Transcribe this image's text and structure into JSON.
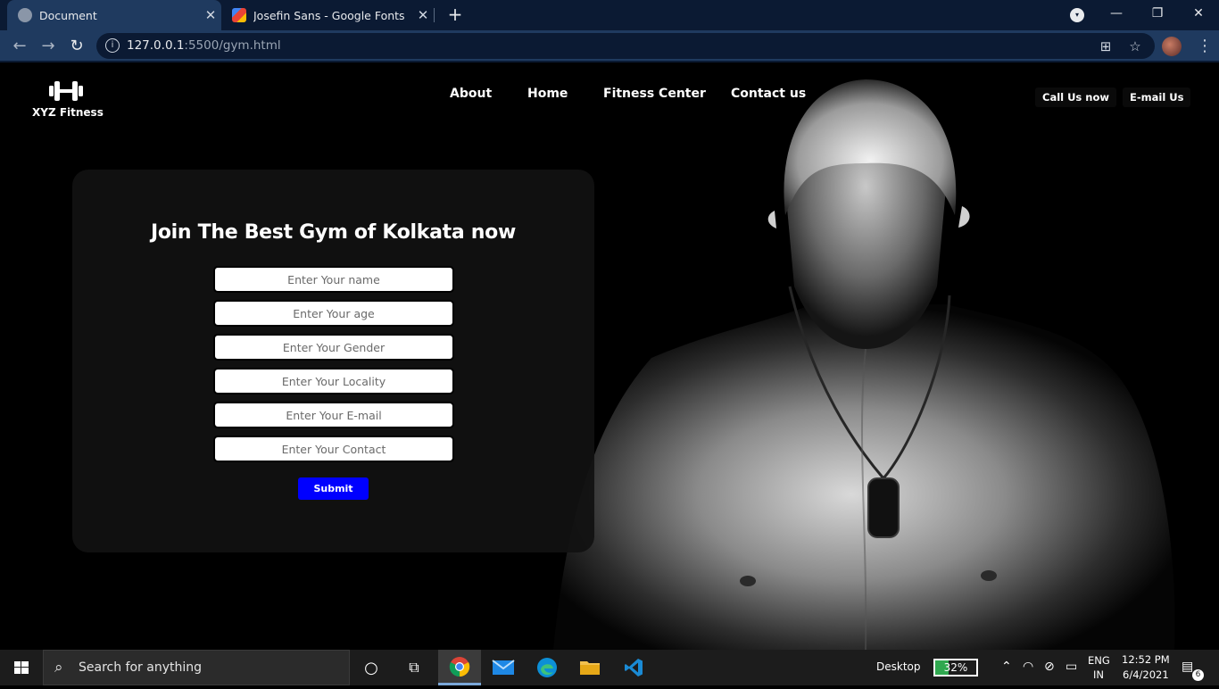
{
  "browser": {
    "tabs": [
      {
        "title": "Document",
        "active": true
      },
      {
        "title": "Josefin Sans - Google Fonts",
        "active": false
      }
    ],
    "url_host": "127.0.0.1",
    "url_rest": ":5500/gym.html",
    "icons": {
      "back": "←",
      "forward": "→",
      "reload": "↻",
      "info": "i",
      "translate": "⊞",
      "star": "☆",
      "menu": "⋮",
      "close": "✕",
      "newtab": "+",
      "minimize": "—",
      "maximize": "❐",
      "profile_dropdown": "▾"
    }
  },
  "site": {
    "brand": {
      "name": "XYZ Fitness",
      "icon": "dumbbell-icon"
    },
    "nav": [
      "About",
      "Home",
      "Fitness Center",
      "Contact us"
    ],
    "cta": {
      "call": "Call Us now",
      "email": "E-mail Us"
    },
    "form": {
      "title": "Join The Best Gym of Kolkata now",
      "fields": [
        {
          "placeholder": "Enter Your name"
        },
        {
          "placeholder": "Enter Your age"
        },
        {
          "placeholder": "Enter Your Gender"
        },
        {
          "placeholder": "Enter Your Locality"
        },
        {
          "placeholder": "Enter Your E-mail"
        },
        {
          "placeholder": "Enter Your Contact"
        }
      ],
      "submit_label": "Submit"
    },
    "colors": {
      "background": "#000000",
      "card": "#111111",
      "submit": "#0000ff",
      "text": "#ffffff"
    }
  },
  "taskbar": {
    "search_placeholder": "Search for anything",
    "desktop_label": "Desktop",
    "battery_percent": "32%",
    "battery_level": 0.32,
    "language": "ENG",
    "region": "IN",
    "time": "12:52 PM",
    "date": "6/4/2021",
    "notification_count": "6",
    "apps": [
      "chrome-icon",
      "mail-icon",
      "edge-icon",
      "file-explorer-icon",
      "vscode-icon"
    ],
    "icons": {
      "search": "⌕",
      "cortana": "○",
      "task_view": "⧉",
      "chevron_up": "⌃",
      "wifi": "◠",
      "network": "⊘",
      "battery_tray": "▭",
      "notifications": "▤"
    }
  }
}
